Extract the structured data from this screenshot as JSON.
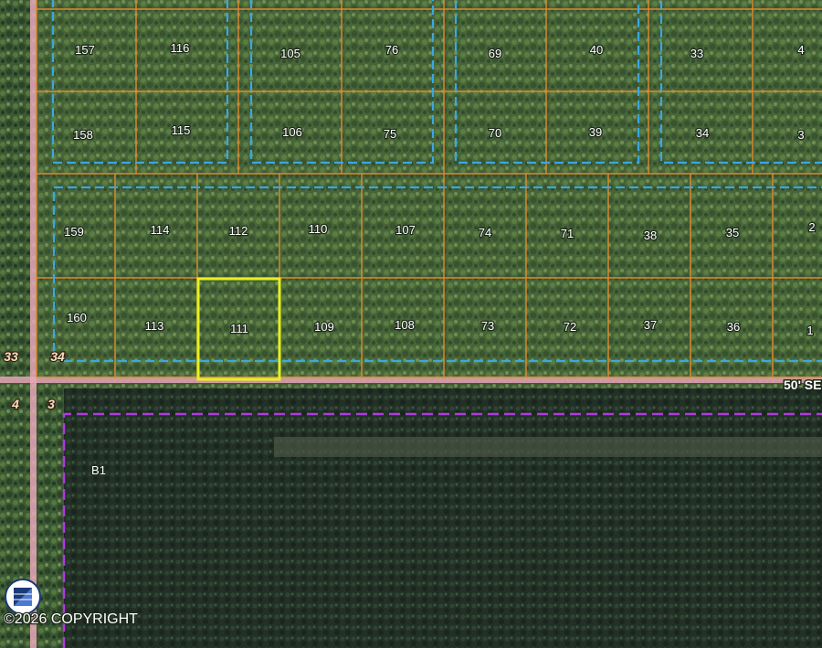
{
  "map": {
    "parcel_labels": [
      {
        "text": "157"
      },
      {
        "text": "116"
      },
      {
        "text": "105"
      },
      {
        "text": "76"
      },
      {
        "text": "69"
      },
      {
        "text": "40"
      },
      {
        "text": "33"
      },
      {
        "text": "4"
      },
      {
        "text": "158"
      },
      {
        "text": "115"
      },
      {
        "text": "106"
      },
      {
        "text": "75"
      },
      {
        "text": "70"
      },
      {
        "text": "39"
      },
      {
        "text": "34"
      },
      {
        "text": "3"
      },
      {
        "text": "159"
      },
      {
        "text": "114"
      },
      {
        "text": "112"
      },
      {
        "text": "110"
      },
      {
        "text": "107"
      },
      {
        "text": "74"
      },
      {
        "text": "71"
      },
      {
        "text": "38"
      },
      {
        "text": "35"
      },
      {
        "text": "2"
      },
      {
        "text": "160"
      },
      {
        "text": "113"
      },
      {
        "text": "111"
      },
      {
        "text": "109"
      },
      {
        "text": "108"
      },
      {
        "text": "73"
      },
      {
        "text": "72"
      },
      {
        "text": "37"
      },
      {
        "text": "36"
      },
      {
        "text": "1"
      }
    ],
    "section_labels": [
      {
        "text": "33"
      },
      {
        "text": "34"
      },
      {
        "text": "4"
      },
      {
        "text": "3"
      }
    ],
    "road_label": "50' SE",
    "block_label": "B1",
    "selected_parcel": "111",
    "copyright": "©2026 COPYRIGHT",
    "colors": {
      "parcel_line": "#e08a2e",
      "subdivision_line": "#3aa8e0",
      "road": "#e8a8b8",
      "selection": "#e8f020",
      "block_boundary": "#b03ae0"
    }
  }
}
